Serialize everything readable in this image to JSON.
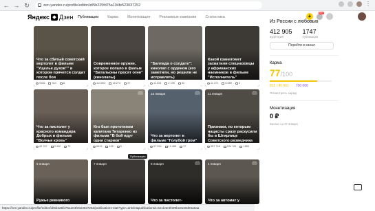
{
  "browser": {
    "url": "zen.yandex.ru/profile/editor/id/5b225fd75a104fe523037252"
  },
  "header": {
    "logo_yandex": "Яндекс",
    "logo_zen": "Дзен",
    "tabs": [
      "Публикации",
      "Карма",
      "Монетизация",
      "Рекламные кампании",
      "Статистика"
    ],
    "notification_badge": "99+"
  },
  "cards": [
    {
      "title": "Что за сбитый советский вертолет в фильме \"Ущелье духов\"\" в котором прячется солдат после боя",
      "views": "9166",
      "reads": "510",
      "comments": "8",
      "date": "",
      "photo": "#5a5347"
    },
    {
      "title": "Современное оружие, которое попало в фильм \"Батальоны просят огня\" (кинолапы)",
      "views": "113 802",
      "reads": "18 274",
      "comments": "37",
      "date": "",
      "photo": "#4a4540"
    },
    {
      "title": "\"Баллада о солдате\": кинолап с орденом (его заметили, но решили не исправлять)",
      "views": "11 324",
      "reads": "2 195",
      "comments": "52",
      "date": "",
      "photo": "#6e6a63"
    },
    {
      "title": "Какой гранатомет захватили спецназовцы у африканских наемников в фильме \"Исполнитель\"",
      "views": "11 371",
      "reads": "6 689",
      "comments": "0",
      "date": "",
      "photo": "#3d3a36"
    },
    {
      "title": "Что за пистолет у красного командира Добрых в фильме \"Волчья кровь\"",
      "views": "40 787",
      "reads": "3 492",
      "comments": "73",
      "date": "",
      "photo": "#6b6058"
    },
    {
      "title": "Кто был прототипом капитана Титаренко из фильма \"В бой идут одни старики\"",
      "views": "6013",
      "reads": "105",
      "comments": "5",
      "date": "",
      "photo": "#8a8478"
    },
    {
      "title": "Что за вертолет в фильме \"Голубой гром\"",
      "views": "57 034",
      "reads": "10 485",
      "comments": "37",
      "date": "13 января",
      "photo": "#56616e"
    },
    {
      "title": "Признаки, по которым нацисты сразу раскусили бы в Штирлице Советского разведчика",
      "views": "957 748",
      "reads": "294 781",
      "comments": "1655",
      "date": "11 января",
      "photo": "#4f4b45"
    },
    {
      "title": "Ружье ревнивого",
      "views": "",
      "reads": "",
      "comments": "",
      "date": "6 января",
      "photo": "#6a6258"
    },
    {
      "title": "",
      "views": "",
      "reads": "",
      "comments": "",
      "date": "7 января",
      "photo": "#3b3835"
    },
    {
      "title": "Что за пистолет-",
      "views": "",
      "reads": "",
      "comments": "",
      "date": "6 января",
      "photo": "#2f2d2a"
    },
    {
      "title": "Что за автомат у",
      "views": "",
      "reads": "",
      "comments": "",
      "date": "4 января",
      "photo": "#5c5750"
    }
  ],
  "tooltip": "Публикации",
  "sidebar": {
    "channel": "Из России с любовью",
    "subscribers_value": "412 905",
    "subscribers_label": "аудитория",
    "publications_value": "1747",
    "publications_label": "публикации",
    "go_button": "Перейти в канал",
    "karma_title": "Карма",
    "karma_value": "77",
    "karma_max": "/100",
    "karma_fraction": 0.77,
    "karma_a_value": "812 / 45 661",
    "karma_a_label": "",
    "karma_b_value": "700 000",
    "karma_b_label": "",
    "karma_link": "Посмотреть карму",
    "money_title": "Монетизация",
    "money_value": "0 ₽",
    "money_note": "Баланс на 27 января"
  },
  "status_url": "https://zen.yandex.ru/profile/editor/id/5b225fd75a104fe523037252/publications-stat?type=article&publicationId=5e1b4e3f499b18160d94a6aa"
}
